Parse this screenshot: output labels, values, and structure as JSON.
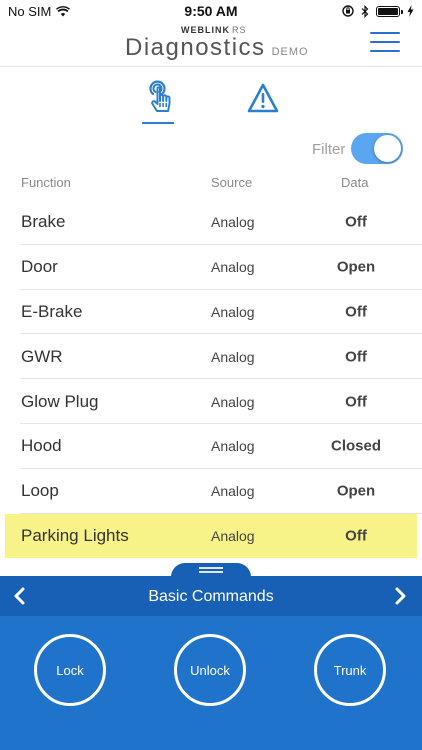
{
  "status_bar": {
    "carrier": "No SIM",
    "time": "9:50 AM"
  },
  "header": {
    "brand": "WEBLINK",
    "brand_suffix": "RS",
    "title": "Diagnostics",
    "mode": "DEMO"
  },
  "tabs": [
    {
      "name": "diagnostics-touch",
      "icon": "touch-hand-icon",
      "active": true
    },
    {
      "name": "alerts",
      "icon": "warning-icon",
      "active": false
    }
  ],
  "filter": {
    "label": "Filter",
    "enabled": true
  },
  "table": {
    "headers": {
      "function": "Function",
      "source": "Source",
      "data": "Data"
    },
    "rows": [
      {
        "function": "Brake",
        "source": "Analog",
        "data": "Off"
      },
      {
        "function": "Door",
        "source": "Analog",
        "data": "Open"
      },
      {
        "function": "E-Brake",
        "source": "Analog",
        "data": "Off"
      },
      {
        "function": "GWR",
        "source": "Analog",
        "data": "Off"
      },
      {
        "function": "Glow Plug",
        "source": "Analog",
        "data": "Off"
      },
      {
        "function": "Hood",
        "source": "Analog",
        "data": "Closed"
      },
      {
        "function": "Loop",
        "source": "Analog",
        "data": "Open"
      },
      {
        "function": "Parking Lights",
        "source": "Analog",
        "data": "Off"
      }
    ],
    "highlighted_row": 7
  },
  "commands": {
    "title": "Basic Commands",
    "lock": "Lock",
    "unlock": "Unlock",
    "trunk": "Trunk"
  },
  "colors": {
    "accent": "#2a7fd1",
    "panel": "#1f73cb",
    "panel_bar": "#1860b5",
    "highlight": "#f7f389",
    "toggle": "#5aa6f0"
  }
}
